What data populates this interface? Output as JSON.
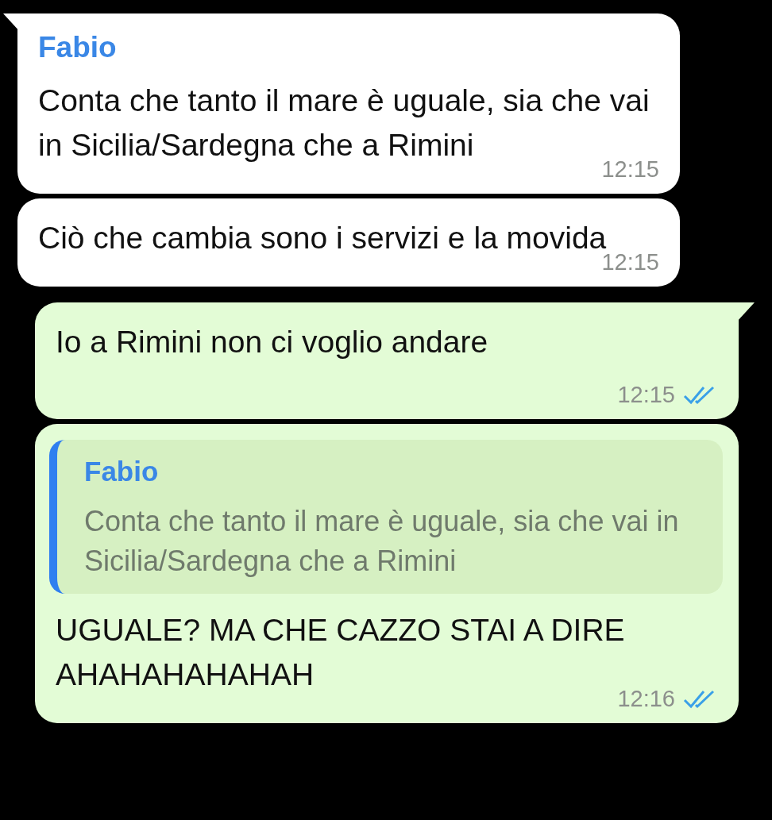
{
  "messages": [
    {
      "kind": "incoming",
      "tail": true,
      "sender": "Fabio",
      "text": "Conta che tanto il mare è uguale, sia che vai in Sicilia/Sardegna che a Rimini",
      "time": "12:15"
    },
    {
      "kind": "incoming",
      "tail": false,
      "text": "Ciò che cambia sono i servizi e la movida",
      "time": "12:15"
    },
    {
      "kind": "outgoing",
      "tail": true,
      "text": "Io a Rimini non ci voglio andare",
      "time": "12:15",
      "read": true
    },
    {
      "kind": "outgoing",
      "tail": false,
      "quote": {
        "sender": "Fabio",
        "text": "Conta che tanto il mare è uguale, sia che vai in Sicilia/Sardegna che a Rimini"
      },
      "text": "UGUALE? MA CHE CAZZO STAI A DIRE AHAHAHAHAHAH",
      "time": "12:16",
      "read": true
    }
  ]
}
